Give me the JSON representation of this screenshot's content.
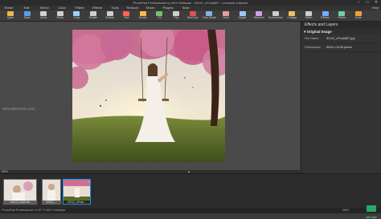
{
  "window": {
    "title": "PhotoPad Professional by NCH Software - 52112_nPvuk867 - Licensed software"
  },
  "menu": [
    "Home",
    "Edit",
    "Select",
    "Color",
    "Filters",
    "Effects",
    "Tools",
    "Retouch",
    "Share",
    "Plugins",
    "Suite"
  ],
  "menu_right": "Help",
  "toolbar": [
    {
      "label": "Open",
      "icon": "open-folder-icon",
      "color": "#e8b84a"
    },
    {
      "label": "Save",
      "icon": "save-icon",
      "color": "#5aa0e8"
    },
    {
      "label": "Undo",
      "icon": "undo-icon",
      "color": "#cfcfcf"
    },
    {
      "label": "Redo",
      "icon": "redo-icon",
      "color": "#cfcfcf"
    },
    {
      "label": "Crop",
      "icon": "crop-icon",
      "color": "#9ed0ff"
    },
    {
      "label": "Rotate",
      "icon": "rotate-icon",
      "color": "#cfcfcf"
    },
    {
      "label": "Resize",
      "icon": "resize-icon",
      "color": "#cfcfcf"
    },
    {
      "label": "Text",
      "icon": "text-icon",
      "color": "#ff6060"
    },
    {
      "label": "Brush",
      "icon": "brush-icon",
      "color": "#ffb84a"
    },
    {
      "label": "Fill",
      "icon": "fill-icon",
      "color": "#70c070"
    },
    {
      "label": "Flip",
      "icon": "flip-icon",
      "color": "#cfcfcf"
    },
    {
      "label": "Red Eye",
      "icon": "red-eye-icon",
      "color": "#e05050"
    },
    {
      "label": "Fine Detail",
      "icon": "fine-detail-icon",
      "color": "#8ab0e0"
    },
    {
      "label": "Heal",
      "icon": "heal-icon",
      "color": "#e0a0a0"
    },
    {
      "label": "Adjust",
      "icon": "adjust-icon",
      "color": "#a0c8ff"
    },
    {
      "label": "Retouch",
      "icon": "retouch-icon",
      "color": "#d0a0e0"
    },
    {
      "label": "Screenshot",
      "icon": "screenshot-icon",
      "color": "#cfcfcf"
    },
    {
      "label": "Collage",
      "icon": "collage-icon",
      "color": "#f0c060"
    },
    {
      "label": "Stitch",
      "icon": "stitch-icon",
      "color": "#cfcfcf"
    },
    {
      "label": "Effects",
      "icon": "effects-icon",
      "color": "#6fb0ff"
    },
    {
      "label": "Filters",
      "icon": "filters-icon",
      "color": "#6fd0a0"
    },
    {
      "label": "Suite",
      "icon": "suite-icon",
      "color": "#f0a040"
    }
  ],
  "panel": {
    "title": "Effects and Layers",
    "section": "Original Image",
    "rows": [
      {
        "key": "File Name",
        "value": "52112_nPvuk867.jpg"
      },
      {
        "key": "Dimensions",
        "value": "5616 x 5136 pixels"
      }
    ]
  },
  "canvas": {
    "watermark": "www.MacDown.com",
    "zoom": "55%"
  },
  "filmstrip": [
    {
      "name": "52112_LZdZLfbe",
      "selected": false
    },
    {
      "name": "52112_...",
      "selected": false
    },
    {
      "name": "52112_nPvuk...",
      "selected": true
    }
  ],
  "status": {
    "left": "PhotoPad Professional v 6.37 © NCH Software",
    "zoom": "55%"
  },
  "logo": {
    "text": "xz7.com"
  }
}
